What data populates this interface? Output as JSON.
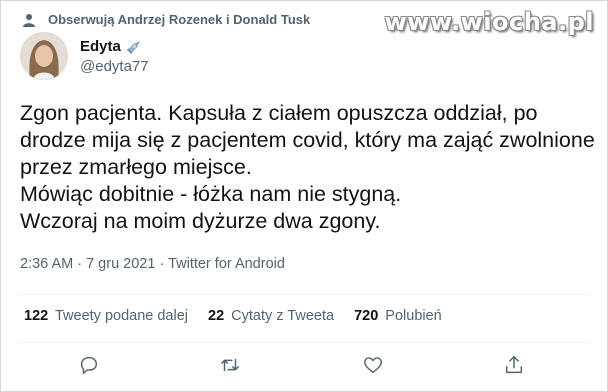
{
  "social_context": "Obserwują Andrzej Rozenek i Donald Tusk",
  "watermark": "www.wiocha.pl",
  "author": {
    "name": "Edyta",
    "handle": "@edyta77"
  },
  "tweet": {
    "lines": [
      "Zgon pacjenta. Kapsuła z ciałem opuszcza oddział, po drodze mija się z pacjentem covid, który ma zająć zwolnione przez zmarłego miejsce.",
      "Mówiąc dobitnie - łóżka nam nie stygną.",
      "Wczoraj na moim dyżurze dwa zgony."
    ]
  },
  "meta": {
    "time": "2:36 AM",
    "sep": " · ",
    "date": "7 gru 2021",
    "source": "Twitter for Android"
  },
  "stats": {
    "retweets": {
      "count": "122",
      "label": "Tweety podane dalej"
    },
    "quotes": {
      "count": "22",
      "label": "Cytaty z Tweeta"
    },
    "likes": {
      "count": "720",
      "label": "Polubień"
    }
  },
  "icons": {
    "social": "person-icon",
    "badge": "syringe-icon",
    "reply": "reply-icon",
    "retweet": "retweet-icon",
    "like": "heart-icon",
    "share": "share-icon"
  },
  "colors": {
    "text": "#0f1419",
    "secondary": "#536471",
    "divider": "#eff3f4"
  }
}
